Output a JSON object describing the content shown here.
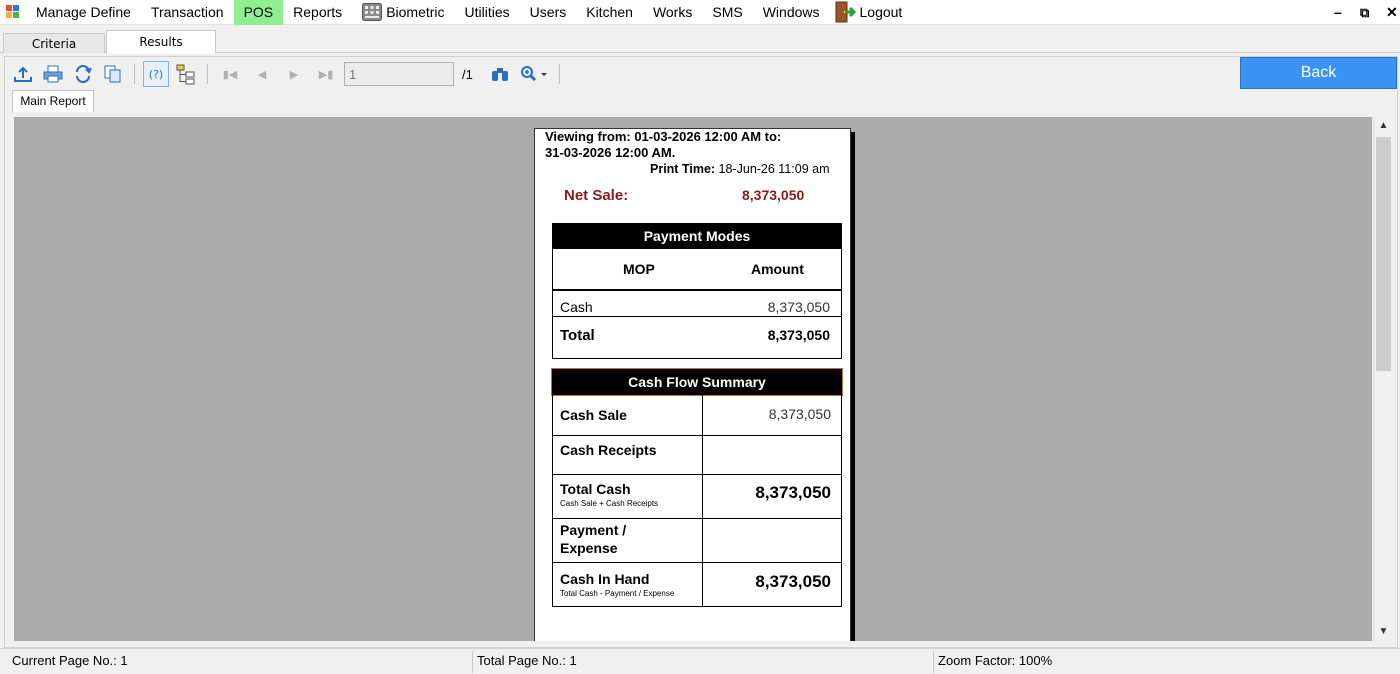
{
  "menu": {
    "items": [
      {
        "label": "Manage Define",
        "icon": ""
      },
      {
        "label": "Transaction",
        "icon": ""
      },
      {
        "label": "POS",
        "icon": ""
      },
      {
        "label": "Reports",
        "icon": ""
      },
      {
        "label": "Biometric",
        "icon": "keypad-icon"
      },
      {
        "label": "Utilities",
        "icon": ""
      },
      {
        "label": "Users",
        "icon": ""
      },
      {
        "label": "Kitchen",
        "icon": ""
      },
      {
        "label": "Works",
        "icon": ""
      },
      {
        "label": "SMS",
        "icon": ""
      },
      {
        "label": "Windows",
        "icon": ""
      },
      {
        "label": "Logout",
        "icon": "door-exit-icon"
      }
    ],
    "active_color": "#90ee90"
  },
  "tabs": {
    "criteria": "Criteria",
    "results": "Results"
  },
  "toolbar": {
    "page_value": "1",
    "page_total": "/1",
    "back_label": "Back",
    "back_color": "#3b93f5"
  },
  "doc_tab": "Main Report",
  "report": {
    "viewing_line1": "Viewing from: 01-03-2026 12:00 AM to:",
    "viewing_line2": "31-03-2026 12:00 AM.",
    "print_time_label": "Print Time:",
    "print_time_value": "18-Jun-26 11:09 am",
    "net_sale_label": "Net Sale:",
    "net_sale_value": "8,373,050",
    "payment_modes": {
      "title": "Payment Modes",
      "col_mop": "MOP",
      "col_amount": "Amount",
      "rows": [
        {
          "mop": "Cash",
          "amount": "8,373,050"
        }
      ],
      "total_label": "Total",
      "total_value": "8,373,050"
    },
    "cash_flow": {
      "title": "Cash Flow Summary",
      "cash_sale_label": "Cash Sale",
      "cash_sale_value": "8,373,050",
      "cash_receipts_label": "Cash Receipts",
      "total_cash_label": "Total Cash",
      "total_cash_sub": "Cash Sale + Cash Receipts",
      "total_cash_value": "8,373,050",
      "payment_line1": "Payment /",
      "payment_line2": "Expense",
      "cash_in_hand_label": "Cash In Hand",
      "cash_in_hand_sub": "Total Cash - Payment / Expense",
      "cash_in_hand_value": "8,373,050"
    }
  },
  "status": {
    "current_page": "Current Page No.: 1",
    "total_page": "Total Page No.: 1",
    "zoom": "Zoom Factor: 100%"
  }
}
